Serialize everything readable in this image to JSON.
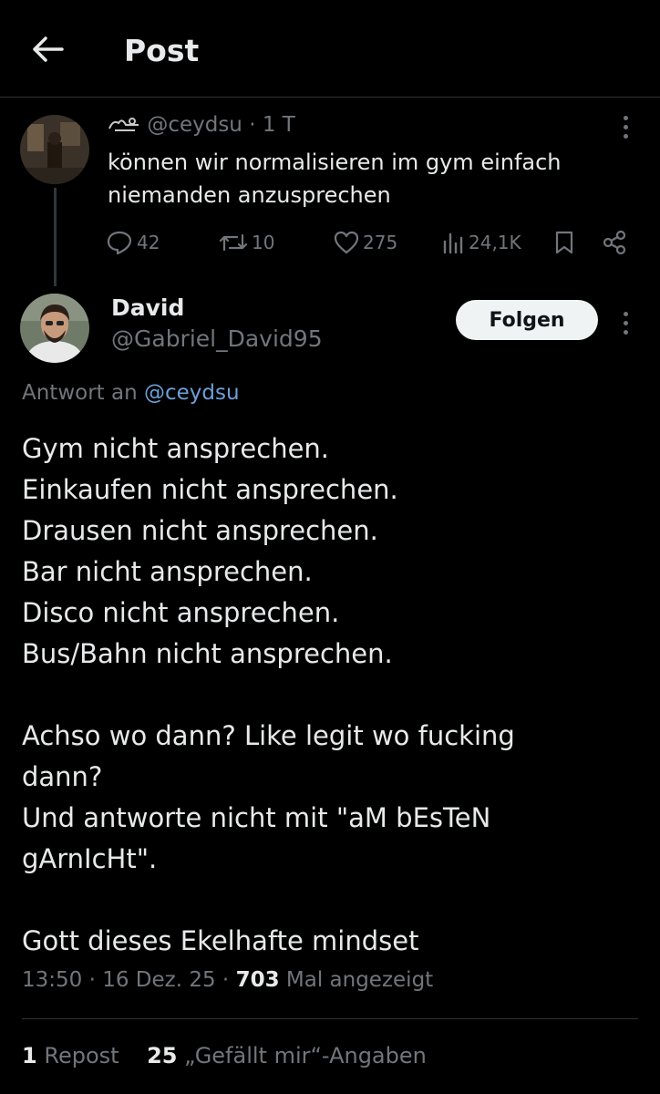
{
  "header": {
    "title": "Post",
    "back_icon": "arrow-left-icon"
  },
  "parent": {
    "handle": "@ceydsu",
    "time": "· 1 T",
    "text": "können wir normalisieren im gym einfach niemanden anzusprechen",
    "replies": "42",
    "reposts": "10",
    "likes": "275",
    "views": "24,1K"
  },
  "reply": {
    "name": "David",
    "handle": "@Gabriel_David95",
    "follow_label": "Folgen",
    "reply_prefix": "Antwort an",
    "reply_to": "@ceydsu",
    "lines": [
      "Gym nicht ansprechen.",
      "Einkaufen nicht ansprechen.",
      "Drausen nicht ansprechen.",
      "Bar nicht ansprechen.",
      "Disco nicht ansprechen.",
      "Bus/Bahn nicht ansprechen."
    ],
    "para2": "Achso wo dann? Like legit wo fucking dann?",
    "para3": "Und antworte nicht mit \"aM bEsTeN gArnIcHt\".",
    "para4": "Gott dieses Ekelhafte mindset",
    "timestamp": "13:50 · 16 Dez. 25 ·",
    "views_count": "703",
    "views_label": "Mal angezeigt",
    "repost_count": "1",
    "repost_label": "Repost",
    "likes_count": "25",
    "likes_label": "„Gefällt mir“-Angaben"
  },
  "colors": {
    "background": "#000000",
    "text": "#e7e9ea",
    "muted": "#71767b",
    "link": "#6e9fd8",
    "follow_bg": "#eff3f4"
  }
}
